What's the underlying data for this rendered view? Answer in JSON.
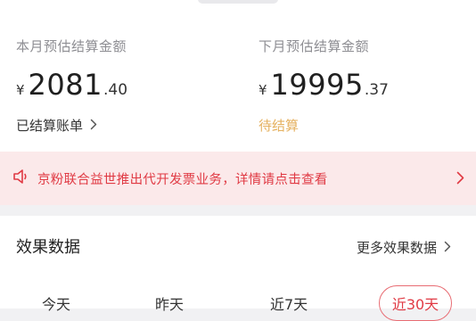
{
  "earnings": {
    "this_month": {
      "label": "本月预估结算金额",
      "currency": "¥",
      "amount_int": "2081",
      "amount_dec": ".40",
      "link": "已结算账单"
    },
    "next_month": {
      "label": "下月预估结算金额",
      "currency": "¥",
      "amount_int": "19995",
      "amount_dec": ".37",
      "status": "待结算"
    }
  },
  "notice": {
    "icon": "speaker-icon",
    "text": "京粉联合益世推出代开发票业务，详情请点击查看"
  },
  "effect_data": {
    "title": "效果数据",
    "more_link": "更多效果数据",
    "tabs": [
      {
        "label": "今天"
      },
      {
        "label": "昨天"
      },
      {
        "label": "近7天"
      },
      {
        "label": "近30天",
        "selected": true
      }
    ]
  },
  "colors": {
    "accent_red": "#e03a44",
    "pending_gold": "#e5b160",
    "notice_bg": "#fbe9ea"
  }
}
